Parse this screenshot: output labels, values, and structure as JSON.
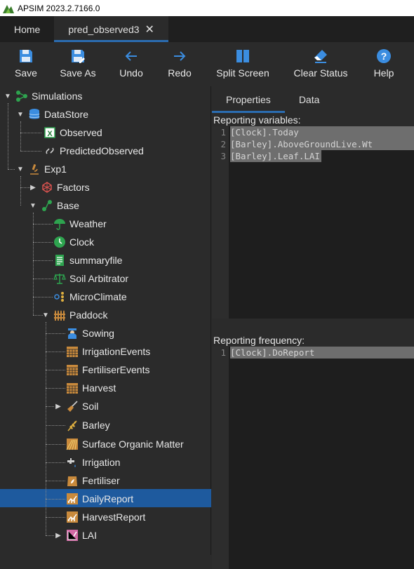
{
  "window": {
    "title": "APSIM 2023.2.7166.0"
  },
  "tabs": [
    {
      "label": "Home"
    },
    {
      "label": "pred_observed3"
    }
  ],
  "toolbar": {
    "save": "Save",
    "save_as": "Save As",
    "undo": "Undo",
    "redo": "Redo",
    "split_screen": "Split Screen",
    "clear_status": "Clear Status",
    "help": "Help"
  },
  "tree": {
    "simulations": "Simulations",
    "datastore": "DataStore",
    "observed": "Observed",
    "predicted_observed": "PredictedObserved",
    "exp1": "Exp1",
    "factors": "Factors",
    "base": "Base",
    "weather": "Weather",
    "clock": "Clock",
    "summaryfile": "summaryfile",
    "soil_arbitrator": "Soil Arbitrator",
    "microclimate": "MicroClimate",
    "paddock": "Paddock",
    "sowing": "Sowing",
    "irrigation_events": "IrrigationEvents",
    "fertiliser_events": "FertiliserEvents",
    "harvest": "Harvest",
    "soil": "Soil",
    "barley": "Barley",
    "surface_organic_matter": "Surface Organic Matter",
    "irrigation": "Irrigation",
    "fertiliser": "Fertiliser",
    "daily_report": "DailyReport",
    "harvest_report": "HarvestReport",
    "lai": "LAI"
  },
  "right_tabs": [
    {
      "label": "Properties"
    },
    {
      "label": "Data"
    }
  ],
  "reporting_variables": {
    "label": "Reporting variables:",
    "lines": [
      {
        "num": "1",
        "text": "[Clock].Today"
      },
      {
        "num": "2",
        "text": "[Barley].AboveGroundLive.Wt"
      },
      {
        "num": "3",
        "text": "[Barley].Leaf.LAI"
      }
    ]
  },
  "reporting_frequency": {
    "label": "Reporting frequency:",
    "lines": [
      {
        "num": "1",
        "text": "[Clock].DoReport"
      }
    ]
  },
  "colors": {
    "accent": "#2b6cb0",
    "selection": "#1e5a9e",
    "icon_green": "#2ea44f",
    "icon_blue": "#3b8de0",
    "icon_orange": "#c98a3c"
  }
}
